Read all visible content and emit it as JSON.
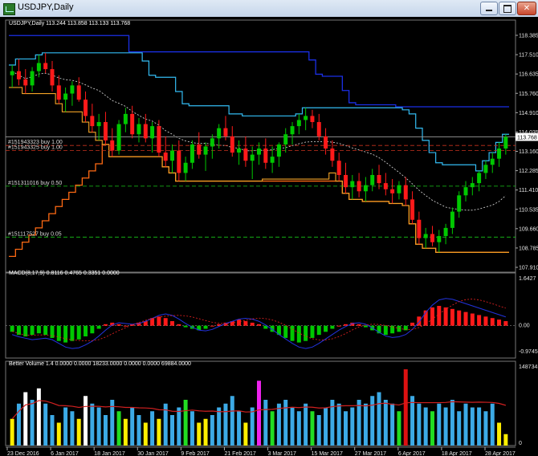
{
  "window": {
    "title": "USDJPY,Daily",
    "minimize_glyph": "",
    "maximize_glyph": "",
    "close_glyph": "✕"
  },
  "colors": {
    "background": "#000000",
    "bull_candle": "#00c800",
    "bear_candle": "#ff1a1a",
    "doji": "#ffffff",
    "upper_channel": "#1b2fe6",
    "lower_channel": "#ff6a13",
    "trail_stop": "#33bbf2",
    "support_line": "#f3a326",
    "dashed_ma": "#e0e0e0",
    "order_line": "#19c819",
    "current_price_line": "#9a9a9a",
    "macd_line": "#2233dd",
    "signal_line": "#ee2222",
    "volume_avg": "#d02020",
    "volume_blue": "#3caae6",
    "volume_white": "#ffffff",
    "volume_yellow": "#ffee00",
    "volume_green": "#22dd22",
    "volume_red": "#dd1111",
    "volume_magenta": "#ee22ee"
  },
  "main_panel": {
    "title": "USDJPY,Daily  113.244 113.858 113.133 113.768",
    "price_axis": [
      "118.385",
      "117.510",
      "116.635",
      "115.760",
      "114.910",
      "114.035",
      "113.160",
      "112.285",
      "111.410",
      "110.535",
      "109.660",
      "108.785",
      "107.910"
    ],
    "current_price": "113.768",
    "orders": [
      {
        "label": "#151943323 buy 1.00",
        "price": 113.35
      },
      {
        "label": "#151943325 buy 1.00",
        "price": 113.1
      },
      {
        "label": "#151311016 buy 0.50",
        "price": 111.35
      },
      {
        "label": "#151117527 buy 0.05",
        "price": 108.85
      }
    ]
  },
  "macd_panel": {
    "title": "MACD(8,17,9) 0.8116 0.4765 0.3351 0.0000",
    "scale": [
      "1.6427",
      "0.00",
      "-0.9745"
    ]
  },
  "volume_panel": {
    "title": "Better Volume 1.4 0.0000 0.0000 18233.0000 0.0000 0.0000 69884.0000",
    "scale": [
      "148734",
      "0"
    ]
  },
  "date_axis": [
    "23 Dec 2016",
    "6 Jan 2017",
    "18 Jan 2017",
    "30 Jan 2017",
    "9 Feb 2017",
    "21 Feb 2017",
    "3 Mar 2017",
    "15 Mar 2017",
    "27 Mar 2017",
    "6 Apr 2017",
    "18 Apr 2017",
    "28 Apr 2017"
  ],
  "chart_data": {
    "type": "candlestick",
    "price_range": [
      107.6,
      118.8
    ],
    "candles": [
      [
        116.8,
        117.3,
        116.2,
        117.0
      ],
      [
        117.0,
        117.6,
        116.3,
        116.6
      ],
      [
        116.6,
        117.1,
        115.9,
        116.3
      ],
      [
        116.3,
        117.2,
        116.0,
        117.0
      ],
      [
        117.0,
        117.8,
        116.7,
        117.4
      ],
      [
        117.4,
        117.9,
        116.9,
        117.1
      ],
      [
        117.1,
        117.5,
        116.0,
        116.3
      ],
      [
        116.3,
        116.8,
        115.4,
        115.6
      ],
      [
        115.6,
        116.2,
        115.0,
        115.9
      ],
      [
        115.9,
        116.5,
        115.3,
        116.3
      ],
      [
        116.3,
        116.7,
        115.5,
        115.6
      ],
      [
        115.6,
        116.0,
        114.5,
        114.8
      ],
      [
        114.8,
        115.4,
        114.0,
        114.3
      ],
      [
        114.3,
        114.9,
        113.6,
        114.5
      ],
      [
        114.5,
        115.0,
        113.4,
        113.6
      ],
      [
        113.6,
        114.2,
        112.8,
        113.1
      ],
      [
        113.1,
        114.6,
        112.9,
        114.4
      ],
      [
        114.4,
        115.2,
        114.0,
        114.9
      ],
      [
        114.9,
        115.3,
        113.7,
        113.9
      ],
      [
        113.9,
        114.7,
        113.5,
        114.4
      ],
      [
        114.4,
        114.9,
        113.5,
        113.7
      ],
      [
        113.7,
        114.5,
        113.0,
        114.3
      ],
      [
        114.3,
        114.6,
        112.8,
        113.0
      ],
      [
        113.0,
        113.8,
        112.3,
        112.6
      ],
      [
        112.6,
        113.4,
        112.0,
        113.1
      ],
      [
        113.1,
        113.6,
        111.6,
        112.0
      ],
      [
        112.0,
        112.8,
        111.6,
        112.5
      ],
      [
        112.5,
        113.6,
        112.2,
        113.4
      ],
      [
        113.4,
        114.0,
        112.7,
        112.9
      ],
      [
        112.9,
        113.5,
        112.1,
        113.3
      ],
      [
        113.3,
        113.9,
        112.7,
        113.7
      ],
      [
        113.7,
        114.4,
        113.2,
        114.2
      ],
      [
        114.2,
        114.8,
        113.6,
        113.8
      ],
      [
        113.8,
        114.3,
        112.8,
        113.0
      ],
      [
        113.0,
        113.6,
        112.4,
        113.2
      ],
      [
        113.2,
        113.8,
        112.3,
        112.6
      ],
      [
        112.6,
        113.3,
        111.7,
        112.9
      ],
      [
        112.9,
        113.5,
        112.4,
        113.2
      ],
      [
        113.2,
        113.7,
        112.2,
        112.5
      ],
      [
        112.5,
        113.3,
        112.0,
        112.8
      ],
      [
        112.8,
        113.5,
        112.3,
        113.4
      ],
      [
        113.4,
        114.2,
        113.0,
        113.9
      ],
      [
        113.9,
        114.5,
        113.4,
        114.3
      ],
      [
        114.3,
        114.9,
        113.9,
        114.6
      ],
      [
        114.6,
        115.2,
        114.1,
        114.8
      ],
      [
        114.8,
        115.1,
        114.2,
        114.5
      ],
      [
        114.5,
        114.9,
        113.6,
        113.8
      ],
      [
        113.8,
        114.2,
        112.9,
        113.2
      ],
      [
        113.2,
        113.6,
        112.3,
        112.6
      ],
      [
        112.6,
        113.0,
        111.6,
        111.9
      ],
      [
        111.9,
        112.5,
        111.0,
        111.3
      ],
      [
        111.3,
        111.9,
        110.7,
        111.6
      ],
      [
        111.6,
        112.0,
        110.8,
        111.1
      ],
      [
        111.1,
        111.8,
        110.6,
        111.4
      ],
      [
        111.4,
        112.2,
        111.1,
        111.9
      ],
      [
        111.9,
        112.4,
        111.2,
        111.5
      ],
      [
        111.5,
        112.0,
        110.9,
        111.2
      ],
      [
        111.2,
        111.7,
        110.5,
        111.0
      ],
      [
        111.0,
        111.6,
        110.7,
        111.4
      ],
      [
        111.4,
        111.8,
        110.4,
        110.7
      ],
      [
        110.7,
        111.1,
        109.5,
        109.7
      ],
      [
        109.7,
        110.1,
        108.5,
        108.8
      ],
      [
        108.8,
        109.3,
        108.3,
        109.0
      ],
      [
        109.0,
        109.4,
        108.4,
        108.6
      ],
      [
        108.6,
        109.2,
        108.1,
        108.9
      ],
      [
        108.9,
        109.5,
        108.5,
        109.3
      ],
      [
        109.3,
        110.3,
        109.0,
        110.1
      ],
      [
        110.1,
        111.1,
        109.8,
        110.9
      ],
      [
        110.9,
        111.6,
        110.6,
        111.3
      ],
      [
        111.3,
        111.8,
        110.9,
        111.5
      ],
      [
        111.5,
        112.1,
        111.1,
        112.0
      ],
      [
        112.0,
        112.6,
        111.7,
        112.4
      ],
      [
        112.4,
        113.0,
        112.0,
        112.7
      ],
      [
        112.7,
        113.5,
        112.3,
        113.2
      ],
      [
        113.2,
        113.9,
        112.9,
        113.77
      ]
    ],
    "macd_hist_normalized": [
      -0.2,
      -0.3,
      -0.35,
      -0.3,
      -0.25,
      -0.3,
      -0.4,
      -0.5,
      -0.55,
      -0.5,
      -0.45,
      -0.35,
      -0.25,
      -0.1,
      0.05,
      0.1,
      0.05,
      0.0,
      0.05,
      0.1,
      0.15,
      0.25,
      0.3,
      0.25,
      0.15,
      0.05,
      -0.05,
      -0.1,
      -0.15,
      -0.1,
      0.0,
      0.05,
      0.1,
      0.15,
      0.2,
      0.15,
      0.1,
      0.05,
      -0.1,
      -0.2,
      -0.3,
      -0.4,
      -0.5,
      -0.55,
      -0.5,
      -0.4,
      -0.3,
      -0.2,
      -0.1,
      0.0,
      0.05,
      0.1,
      0.05,
      -0.05,
      -0.15,
      -0.25,
      -0.3,
      -0.25,
      -0.2,
      -0.15,
      0.1,
      0.3,
      0.5,
      0.6,
      0.65,
      0.6,
      0.55,
      0.5,
      0.45,
      0.4,
      0.35,
      0.3,
      0.25,
      0.2,
      0.15
    ],
    "volume_normalized": [
      0.35,
      0.55,
      0.7,
      0.6,
      0.75,
      0.55,
      0.4,
      0.3,
      0.5,
      0.45,
      0.35,
      0.65,
      0.55,
      0.5,
      0.4,
      0.6,
      0.45,
      0.35,
      0.5,
      0.4,
      0.3,
      0.45,
      0.35,
      0.55,
      0.4,
      0.5,
      0.6,
      0.45,
      0.3,
      0.35,
      0.4,
      0.5,
      0.55,
      0.65,
      0.45,
      0.3,
      0.5,
      0.85,
      0.6,
      0.45,
      0.55,
      0.6,
      0.5,
      0.45,
      0.55,
      0.45,
      0.4,
      0.5,
      0.6,
      0.55,
      0.45,
      0.5,
      0.6,
      0.55,
      0.65,
      0.7,
      0.6,
      0.55,
      0.45,
      1.0,
      0.65,
      0.55,
      0.5,
      0.45,
      0.55,
      0.5,
      0.6,
      0.45,
      0.55,
      0.5,
      0.5,
      0.45,
      0.55,
      0.3,
      0.15
    ]
  }
}
